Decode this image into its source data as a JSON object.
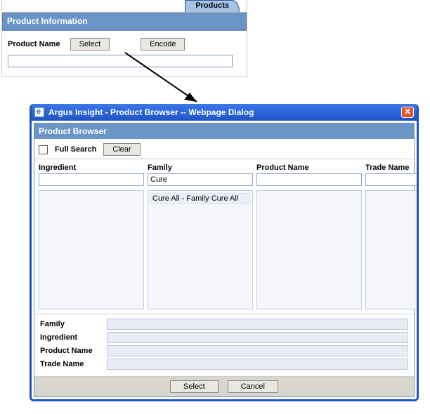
{
  "upper": {
    "tab_label": "Products",
    "panel_title": "Product Information",
    "product_name_label": "Product Name",
    "select_label": "Select",
    "encode_label": "Encode",
    "product_name_value": ""
  },
  "dialog": {
    "window_title": "Argus Insight - Product Browser -- Webpage Dialog",
    "close_glyph": "✕",
    "header": "Product Browser",
    "full_search_label": "Full Search",
    "clear_label": "Clear",
    "columns": {
      "ingredient": {
        "label": "Ingredient",
        "search": "",
        "items": []
      },
      "family": {
        "label": "Family",
        "search": "Cure",
        "items": [
          "Cure All - Family Cure All"
        ]
      },
      "product_name": {
        "label": "Product Name",
        "search": "",
        "items": []
      },
      "trade_name": {
        "label": "Trade Name",
        "search": "",
        "items": []
      }
    },
    "details": {
      "family_label": "Family",
      "ingredient_label": "Ingredient",
      "product_name_label": "Product Name",
      "trade_name_label": "Trade Name"
    },
    "select_label": "Select",
    "cancel_label": "Cancel"
  }
}
